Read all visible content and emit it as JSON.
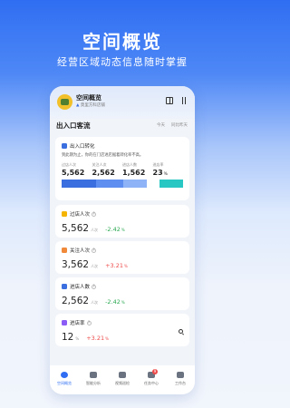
{
  "hero": {
    "title": "空间概览",
    "subtitle": "经营区域动态信息随时掌握"
  },
  "store": {
    "name": "空间概览",
    "branch": "莫里方科店铺"
  },
  "section": {
    "title": "出入口客流",
    "period": "今天",
    "compare": "同比昨天"
  },
  "conversion": {
    "title": "出入口转化",
    "description": "到此期为止，你的在门店进店据着转化率不高。",
    "columns": [
      {
        "label": "过店人次",
        "value": "5,562",
        "unit": ""
      },
      {
        "label": "关注人次",
        "value": "2,562",
        "unit": ""
      },
      {
        "label": "进店人数",
        "value": "1,562",
        "unit": ""
      },
      {
        "label": "进店率",
        "value": "23",
        "unit": "%"
      }
    ],
    "funnel_colors": [
      "#3b6fe0",
      "#5e8ff0",
      "#8eb3f7",
      "#29c7c4"
    ]
  },
  "metrics": [
    {
      "title": "过店人次",
      "value": "5,562",
      "unit": "人次",
      "delta": "-2.42",
      "delta_unit": "%",
      "direction": "down",
      "icon_color": "#f4b400"
    },
    {
      "title": "关注人次",
      "value": "3,562",
      "unit": "人次",
      "delta": "+3.21",
      "delta_unit": "%",
      "direction": "up",
      "icon_color": "#f08a3a"
    },
    {
      "title": "进店人数",
      "value": "2,562",
      "unit": "人次",
      "delta": "-2.42",
      "delta_unit": "%",
      "direction": "down",
      "icon_color": "#3b6fe0"
    },
    {
      "title": "进店率",
      "value": "12",
      "unit": "%",
      "delta": "+3.21",
      "delta_unit": "%",
      "direction": "up",
      "icon_color": "#8b5cf6"
    }
  ],
  "tabs": [
    {
      "label": "空间概览",
      "active": true,
      "badge": ""
    },
    {
      "label": "智能分析",
      "active": false,
      "badge": ""
    },
    {
      "label": "视频巡检",
      "active": false,
      "badge": ""
    },
    {
      "label": "任务中心",
      "active": false,
      "badge": "9"
    },
    {
      "label": "工作台",
      "active": false,
      "badge": ""
    }
  ]
}
